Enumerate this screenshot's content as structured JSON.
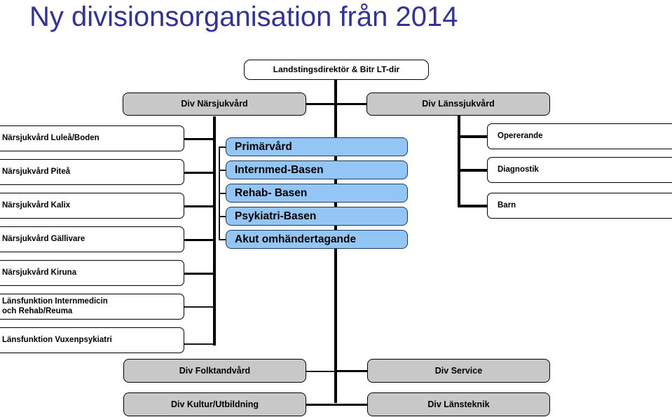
{
  "page": {
    "title": "Ny divisionsorganisation från 2014",
    "title_color": "#32329b",
    "background": "#ffffff"
  },
  "colors": {
    "grey_box": "#c8c8c8",
    "blue_box": "#93c6f5",
    "white_box": "#ffffff",
    "line": "#000000",
    "text": "#000000"
  },
  "org": {
    "root": {
      "label": "Landstingsdirektör & Bitr LT-dir"
    },
    "divisions_top": [
      {
        "label": "Div Närsjukvård"
      },
      {
        "label": "Div Länssjukvård"
      }
    ],
    "narsjukvard_units": [
      {
        "label": "Närsjukvård Luleå/Boden"
      },
      {
        "label": "Närsjukvård Piteå"
      },
      {
        "label": "Närsjukvård Kalix"
      },
      {
        "label": "Närsjukvård Gällivare"
      },
      {
        "label": "Närsjukvård Kiruna"
      },
      {
        "label": "Länsfunktion Internmedicin och Rehab/Reuma"
      },
      {
        "label": "Länsfunktion Vuxenpsykiatri"
      }
    ],
    "baser": [
      {
        "label": "Primärvård"
      },
      {
        "label": "Internmed-Basen"
      },
      {
        "label": "Rehab- Basen"
      },
      {
        "label": "Psykiatri-Basen"
      },
      {
        "label": "Akut omhändertagande"
      }
    ],
    "lanssjukvard_units": [
      {
        "label": "Opererande"
      },
      {
        "label": "Diagnostik"
      },
      {
        "label": "Barn"
      }
    ],
    "divisions_bottom": [
      {
        "label": "Div Folktandvård"
      },
      {
        "label": "Div Service"
      },
      {
        "label": "Div Kultur/Utbildning"
      },
      {
        "label": "Div Länsteknik"
      }
    ]
  }
}
